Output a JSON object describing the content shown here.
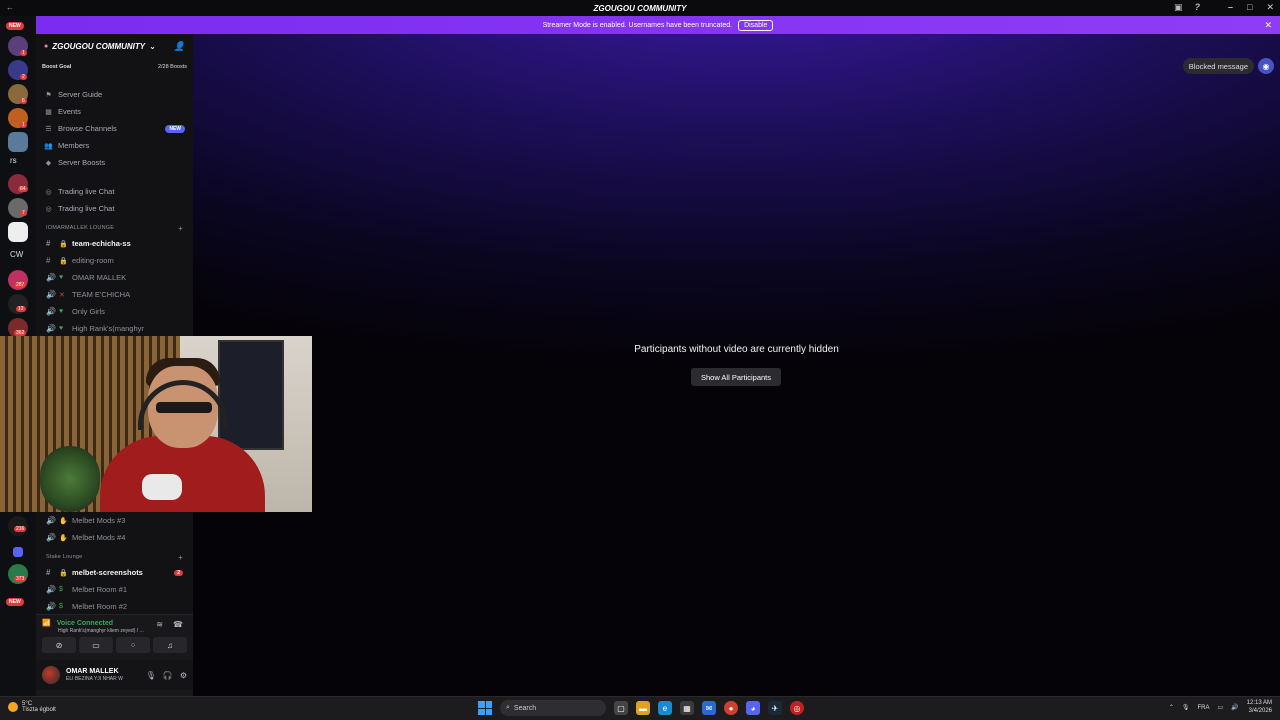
{
  "window": {
    "title": "ZGOUGOU COMMUNITY"
  },
  "banner": {
    "text": "Streamer Mode is enabled. Usernames have been truncated.",
    "button": "Disable"
  },
  "rail": {
    "new_top": "NEW",
    "new_bottom": "NEW",
    "text_rs": "rs",
    "text_cw": "CW",
    "badges": [
      "1",
      "2",
      "6",
      "1",
      "64",
      "7",
      "287",
      "12",
      "362",
      "216",
      "373"
    ]
  },
  "server": {
    "name": "ZGOUGOU COMMUNITY"
  },
  "boost": {
    "label": "Boost Goal",
    "count": "2/28 Boosts"
  },
  "nav": [
    {
      "label": "Server Guide"
    },
    {
      "label": "Events"
    },
    {
      "label": "Browse Channels",
      "pill": "NEW"
    },
    {
      "label": "Members"
    },
    {
      "label": "Server Boosts"
    }
  ],
  "pinned": [
    {
      "label": "Trading live Chat"
    },
    {
      "label": "Trading live Chat"
    }
  ],
  "category1": {
    "label": "IOMARMALLEK LOUNGE"
  },
  "channels1": [
    {
      "label": "team-echicha-ss",
      "bold": true
    },
    {
      "label": "editing-room"
    },
    {
      "label": "OMAR MALLEK"
    },
    {
      "label": "TEAM E'CHICHA"
    },
    {
      "label": "Only Girls"
    },
    {
      "label": "High Rank's(manghyr"
    }
  ],
  "channels_mid": [
    {
      "label": "Melbet Mods #3"
    },
    {
      "label": "Melbet Mods #4"
    }
  ],
  "category2": {
    "label": "Stake Lounge"
  },
  "channels2": [
    {
      "label": "melbet-screenshots",
      "bold": true,
      "badge": "2"
    },
    {
      "label": "Melbet Room #1"
    },
    {
      "label": "Melbet Room #2"
    }
  ],
  "voice": {
    "status": "Voice Connected",
    "channel": "High Rank's(manghyr kliem zeyed) / ..."
  },
  "user": {
    "name": "OMAR MALLEK",
    "status": "ELI BEZINA YJI NHAR W"
  },
  "stage": {
    "message": "Participants without video are currently hidden",
    "button": "Show All Participants",
    "blocked": "Blocked message"
  },
  "taskbar": {
    "weather_temp": "5°C",
    "weather_desc": "Tiszta égbolt",
    "search": "Search",
    "lang": "FRA",
    "time": "12:13 AM",
    "date": "3/4/2026"
  },
  "colors": {
    "accent": "#8a2be2",
    "blurple": "#5865f2",
    "voice_green": "#3ba55c"
  }
}
